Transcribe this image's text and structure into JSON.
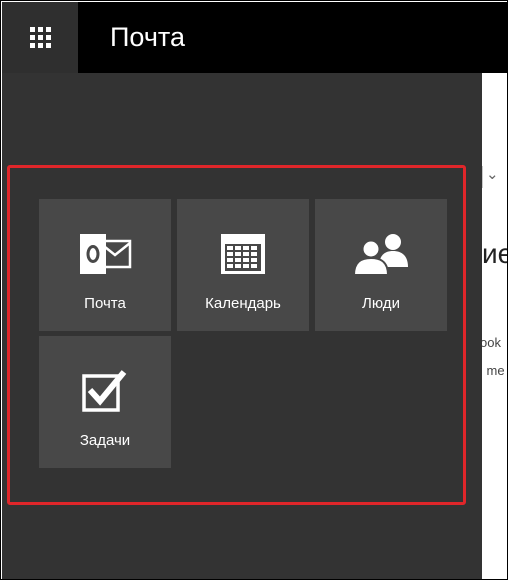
{
  "header": {
    "app_title": "Почта",
    "launcher_icon": "app-launcher-icon"
  },
  "tiles": [
    {
      "label": "Почта",
      "icon": "outlook-mail-icon"
    },
    {
      "label": "Календарь",
      "icon": "calendar-icon"
    },
    {
      "label": "Люди",
      "icon": "people-icon"
    },
    {
      "label": "Задачи",
      "icon": "tasks-checkbox-icon"
    }
  ],
  "background_peek": {
    "heading_fragment": "ие",
    "line1_fragment": "ook",
    "line2_fragment": "l me"
  },
  "colors": {
    "topbar": "#000000",
    "panel": "#333333",
    "tile": "#484848",
    "highlight": "#e0262a"
  }
}
